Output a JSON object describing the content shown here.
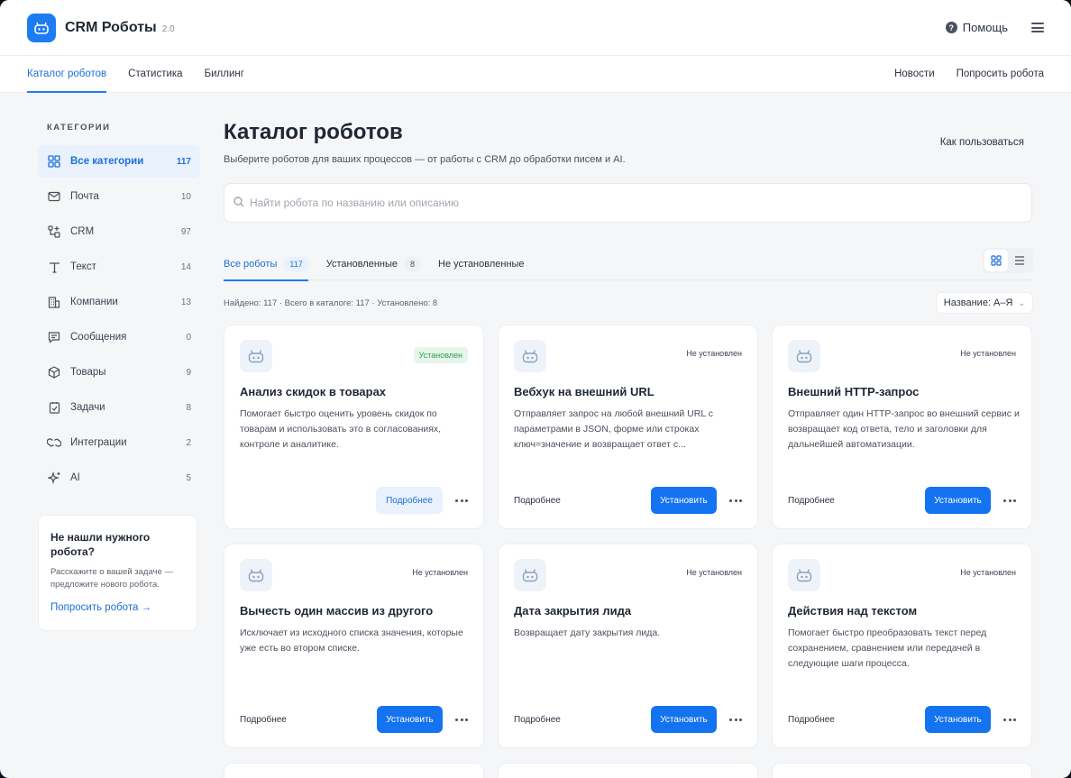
{
  "app": {
    "title": "CRM Роботы",
    "version": "2.0"
  },
  "header": {
    "help_label": "Помощь"
  },
  "nav": {
    "left": [
      "Каталог роботов",
      "Статистика",
      "Биллинг"
    ],
    "right": [
      "Новости",
      "Попросить робота"
    ]
  },
  "sidebar": {
    "heading": "КАТЕГОРИИ",
    "items": [
      {
        "label": "Все категории",
        "count": "117",
        "icon": "grid-icon"
      },
      {
        "label": "Почта",
        "count": "10",
        "icon": "mail-icon"
      },
      {
        "label": "CRM",
        "count": "97",
        "icon": "crm-icon"
      },
      {
        "label": "Текст",
        "count": "14",
        "icon": "text-icon"
      },
      {
        "label": "Компании",
        "count": "13",
        "icon": "building-icon"
      },
      {
        "label": "Сообщения",
        "count": "0",
        "icon": "message-icon"
      },
      {
        "label": "Товары",
        "count": "9",
        "icon": "box-icon"
      },
      {
        "label": "Задачи",
        "count": "8",
        "icon": "checklist-icon"
      },
      {
        "label": "Интеграции",
        "count": "2",
        "icon": "link-icon"
      },
      {
        "label": "AI",
        "count": "5",
        "icon": "sparkle-icon"
      }
    ],
    "help_card": {
      "title": "Не нашли нужного робота?",
      "text": "Расскажите о вашей задаче — предложите нового робота.",
      "link": "Попросить робота →"
    }
  },
  "main": {
    "title": "Каталог роботов",
    "subtitle": "Выберите роботов для ваших процессов — от работы с CRM до обработки писем и AI.",
    "how_to": "Как пользоваться",
    "search_placeholder": "Найти робота по названию или описанию",
    "tabs": [
      {
        "label": "Все роботы",
        "badge": "117"
      },
      {
        "label": "Установленные",
        "badge": "8"
      },
      {
        "label": "Не установленные",
        "badge": ""
      }
    ],
    "found_text": "Найдено: 117 · Всего в каталоге: 117 · Установлено: 8",
    "sort_label": "Название: А–Я"
  },
  "cards": [
    {
      "title": "Анализ скидок в товарах",
      "desc": "Помогает быстро оценить уровень скидок по товарам и использовать это в согласованиях, контроле и аналитике.",
      "status": "Установлен",
      "installed": true,
      "more": "Подробнее",
      "action": ""
    },
    {
      "title": "Вебхук на внешний URL",
      "desc": "Отправляет запрос на любой внешний URL с параметрами в JSON, форме или строках ключ=значение и возвращает ответ с...",
      "status": "Не установлен",
      "installed": false,
      "more": "Подробнее",
      "action": "Установить"
    },
    {
      "title": "Внешний HTTP-запрос",
      "desc": "Отправляет один HTTP-запрос во внешний сервис и возвращает код ответа, тело и заголовки для дальнейшей автоматизации.",
      "status": "Не установлен",
      "installed": false,
      "more": "Подробнее",
      "action": "Установить"
    },
    {
      "title": "Вычесть один массив из другого",
      "desc": "Исключает из исходного списка значения, которые уже есть во втором списке.",
      "status": "Не установлен",
      "installed": false,
      "more": "Подробнее",
      "action": "Установить"
    },
    {
      "title": "Дата закрытия лида",
      "desc": "Возвращает дату закрытия лида.",
      "status": "Не установлен",
      "installed": false,
      "more": "Подробнее",
      "action": "Установить"
    },
    {
      "title": "Действия над текстом",
      "desc": "Помогает быстро преобразовать текст перед сохранением, сравнением или передачей в следующие шаги процесса.",
      "status": "Не установлен",
      "installed": false,
      "more": "Подробнее",
      "action": "Установить"
    }
  ],
  "colors": {
    "accent": "#1d7cf2",
    "installed_bg": "#e6f6ea",
    "installed_fg": "#2f9e4f"
  }
}
